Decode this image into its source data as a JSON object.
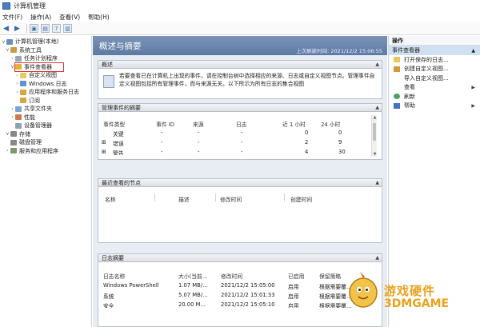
{
  "window": {
    "title": "计算机管理"
  },
  "menu": {
    "items": [
      "文件(F)",
      "操作(A)",
      "查看(V)",
      "帮助(H)"
    ]
  },
  "tree": {
    "root": "计算机管理(本地)",
    "system_tools": "系统工具",
    "task_scheduler": "任务计划程序",
    "event_viewer": "事件查看器",
    "custom_views": "自定义视图",
    "windows_logs": "Windows 日志",
    "app_service_logs": "应用程序和服务日志",
    "subscriptions": "订阅",
    "shared_folders": "共享文件夹",
    "performance": "性能",
    "device_manager": "设备管理器",
    "storage": "存储",
    "disk_management": "磁盘管理",
    "services_apps": "服务和应用程序"
  },
  "center": {
    "banner_title": "概述与摘要",
    "last_refresh": "上次刷新时间: 2021/12/2 15:06:55",
    "overview": {
      "header": "概述",
      "text": "若要查看已在计算机上出现的事件，请在控制台树中选择相应的来源、日志或自定义视图节点。管理事件自定义视图包括所有管理事件，而与来源无关。以下所示为所有日志的集合视图"
    },
    "summary": {
      "header": "管理事件的摘要",
      "columns": [
        "事件类型",
        "事件 ID",
        "来源",
        "日志",
        "近 1 小时",
        "24 小时"
      ],
      "rows": [
        {
          "type": "关键",
          "id": "-",
          "source": "-",
          "log": "-",
          "h1": "0",
          "h24": "0"
        },
        {
          "type": "错误",
          "id": "-",
          "source": "-",
          "log": "-",
          "h1": "2",
          "h24": "9"
        },
        {
          "type": "警告",
          "id": "-",
          "source": "-",
          "log": "-",
          "h1": "4",
          "h24": "30"
        }
      ]
    },
    "recent": {
      "header": "最近查看的节点",
      "columns": [
        "名称",
        "描述",
        "修改时间",
        "创建时间"
      ]
    },
    "logs": {
      "header": "日志摘要",
      "columns": [
        "日志名称",
        "大小(当前...",
        "修改时间",
        "已启用",
        "保留策略"
      ],
      "rows": [
        {
          "name": "Windows PowerShell",
          "size": "1.07 MB/...",
          "modified": "2021/12/2 15:05:00",
          "enabled": "启用",
          "policy": "根据需要覆..."
        },
        {
          "name": "系统",
          "size": "5.07 MB/...",
          "modified": "2021/12/2 15:01:33",
          "enabled": "启用",
          "policy": "根据需要覆..."
        },
        {
          "name": "安全",
          "size": "20.00 M...",
          "modified": "2021/12/2 15:05:10",
          "enabled": "启用",
          "policy": "根据需要覆..."
        }
      ]
    }
  },
  "actions": {
    "header": "操作",
    "subheader": "事件查看器",
    "items": [
      {
        "label": "打开保存的日志...",
        "icon": "folder-open-icon"
      },
      {
        "label": "创建自定义视图...",
        "icon": "filter-icon"
      },
      {
        "label": "导入自定义视图...",
        "icon": "import-icon"
      },
      {
        "label": "查看",
        "icon": "view-icon"
      },
      {
        "label": "刷新",
        "icon": "refresh-icon"
      },
      {
        "label": "帮助",
        "icon": "help-icon"
      }
    ]
  },
  "watermark": {
    "line1": "游戏硬件",
    "line2": "3DMGAME"
  }
}
